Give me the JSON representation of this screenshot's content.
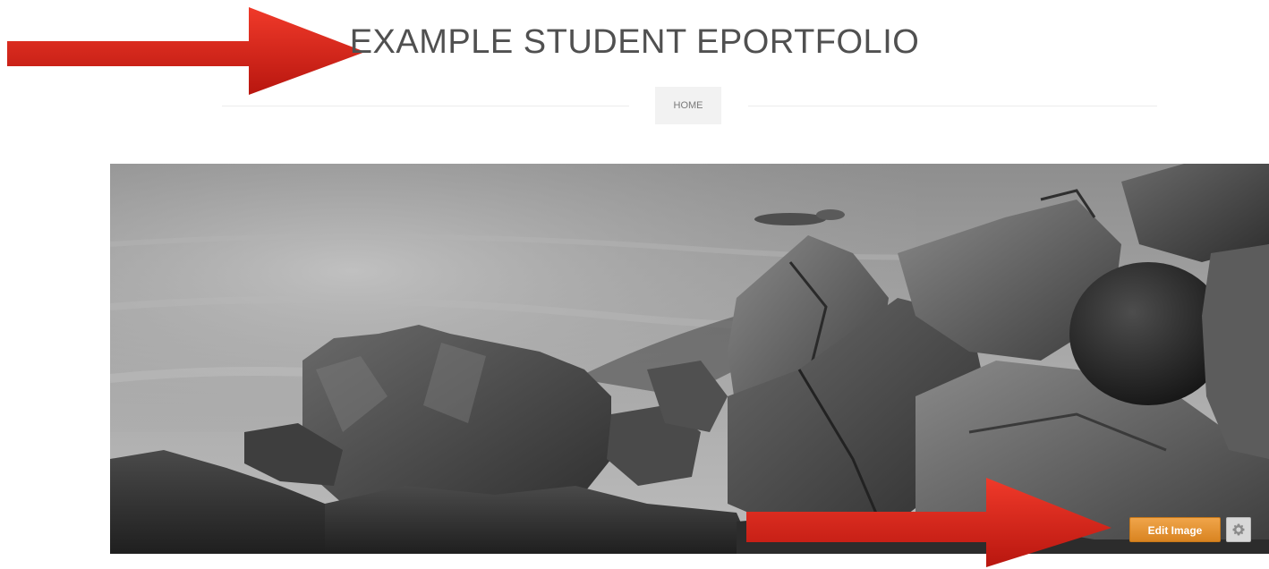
{
  "header": {
    "site_title": "EXAMPLE STUDENT EPORTFOLIO"
  },
  "nav": {
    "items": [
      {
        "label": "HOME"
      }
    ]
  },
  "banner": {
    "edit_image_label": "Edit Image",
    "settings_icon": "gear-icon"
  },
  "annotations": {
    "arrow_color": "#e02a1f"
  },
  "colors": {
    "edit_button": "#e5922f",
    "title_text": "#505050"
  }
}
